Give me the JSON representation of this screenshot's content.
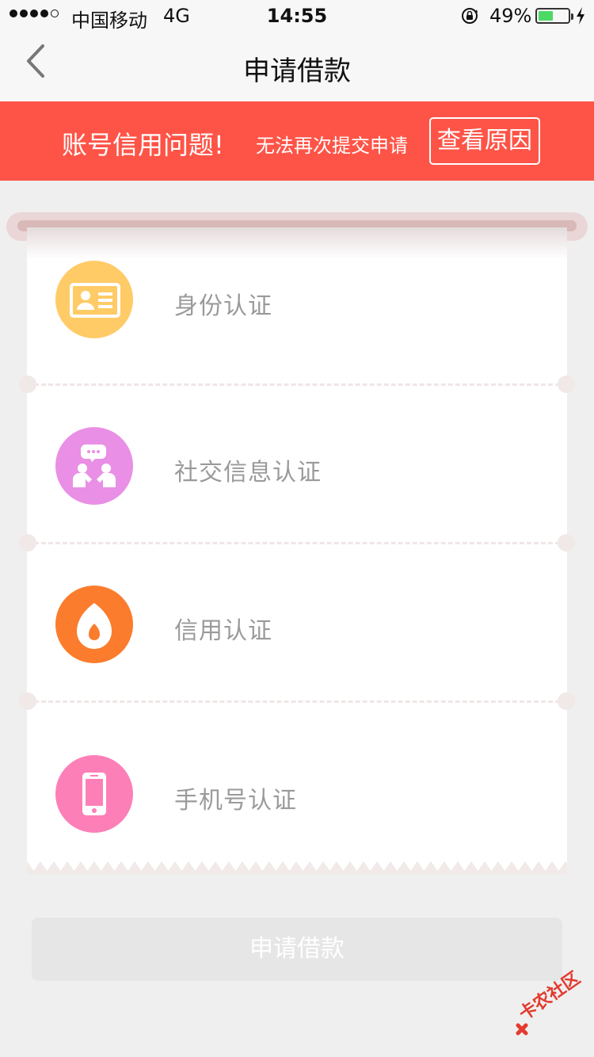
{
  "status_bar": {
    "carrier": "中国移动",
    "network": "4G",
    "time": "14:55",
    "battery_percent": "49%",
    "battery_level": 0.49
  },
  "nav": {
    "title": "申请借款",
    "back_icon": "chevron-left-icon"
  },
  "alert": {
    "title": "账号信用问题!",
    "description": "无法再次提交申请",
    "button_label": "查看原因",
    "background_color": "#fe5447"
  },
  "auth_items": [
    {
      "label": "身份认证",
      "icon": "id-card-icon",
      "color": "#ffcb66"
    },
    {
      "label": "社交信息认证",
      "icon": "social-chat-icon",
      "color": "#e98fe5"
    },
    {
      "label": "信用认证",
      "icon": "credit-drop-icon",
      "color": "#fb7c2c"
    },
    {
      "label": "手机号认证",
      "icon": "mobile-phone-icon",
      "color": "#fd7fb7"
    }
  ],
  "apply_button": {
    "label": "申请借款",
    "state": "disabled"
  },
  "watermark": {
    "text": "卡农社区"
  }
}
